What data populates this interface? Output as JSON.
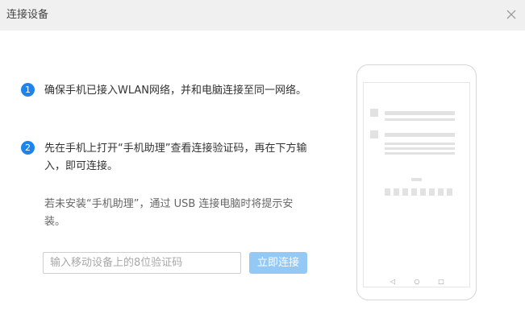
{
  "dialog": {
    "title": "连接设备"
  },
  "steps": [
    {
      "number": "1",
      "text": "确保手机已接入WLAN网络，并和电脑连接至同一网络。"
    },
    {
      "number": "2",
      "text": "先在手机上打开“手机助理”查看连接验证码，再在下方输入，即可连接。"
    }
  ],
  "note": "若未安装“手机助理”，通过 USB 连接电脑时将提示安装。",
  "code_input": {
    "value": "",
    "placeholder": "输入移动设备上的8位验证码"
  },
  "connect_button": {
    "label": "立即连接"
  },
  "phone_nav": {
    "back": "◁",
    "home": "○",
    "recent": "□"
  },
  "colors": {
    "accent": "#1f84ea",
    "button_disabled": "#95c9f5",
    "titlebar": "#f0f0f0"
  }
}
